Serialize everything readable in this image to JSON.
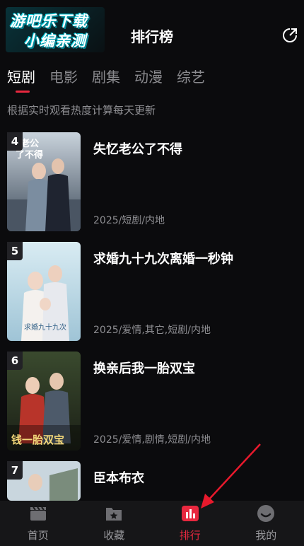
{
  "watermark": {
    "line1": "游吧乐下载",
    "line2": "小编亲测"
  },
  "header": {
    "title": "排行榜",
    "share_icon": "share-icon"
  },
  "tabs": [
    {
      "label": "短剧",
      "active": true
    },
    {
      "label": "电影",
      "active": false
    },
    {
      "label": "剧集",
      "active": false
    },
    {
      "label": "动漫",
      "active": false
    },
    {
      "label": "综艺",
      "active": false
    }
  ],
  "subtitle": "根据实时观看热度计算每天更新",
  "items": [
    {
      "rank": "4",
      "title": "失忆老公了不得",
      "meta": "2025/短剧/内地",
      "poster_text": "失忆老公了不得"
    },
    {
      "rank": "5",
      "title": "求婚九十九次离婚一秒钟",
      "meta": "2025/爱情,其它,短剧/内地",
      "poster_text": "求婚九十九次离婚一秒钟"
    },
    {
      "rank": "6",
      "title": "换亲后我一胎双宝",
      "meta": "2025/爱情,剧情,短剧/内地",
      "poster_text": "换亲后我一胎双宝"
    },
    {
      "rank": "7",
      "title": "臣本布衣",
      "meta": "",
      "poster_text": ""
    }
  ],
  "bottom_nav": [
    {
      "label": "首页",
      "icon": "clapperboard-icon",
      "active": false
    },
    {
      "label": "收藏",
      "icon": "star-folder-icon",
      "active": false
    },
    {
      "label": "排行",
      "icon": "bar-chart-icon",
      "active": true
    },
    {
      "label": "我的",
      "icon": "smile-icon",
      "active": false
    }
  ],
  "colors": {
    "accent": "#e8283f",
    "background": "#0b0b0d",
    "muted": "#8d8d91"
  }
}
